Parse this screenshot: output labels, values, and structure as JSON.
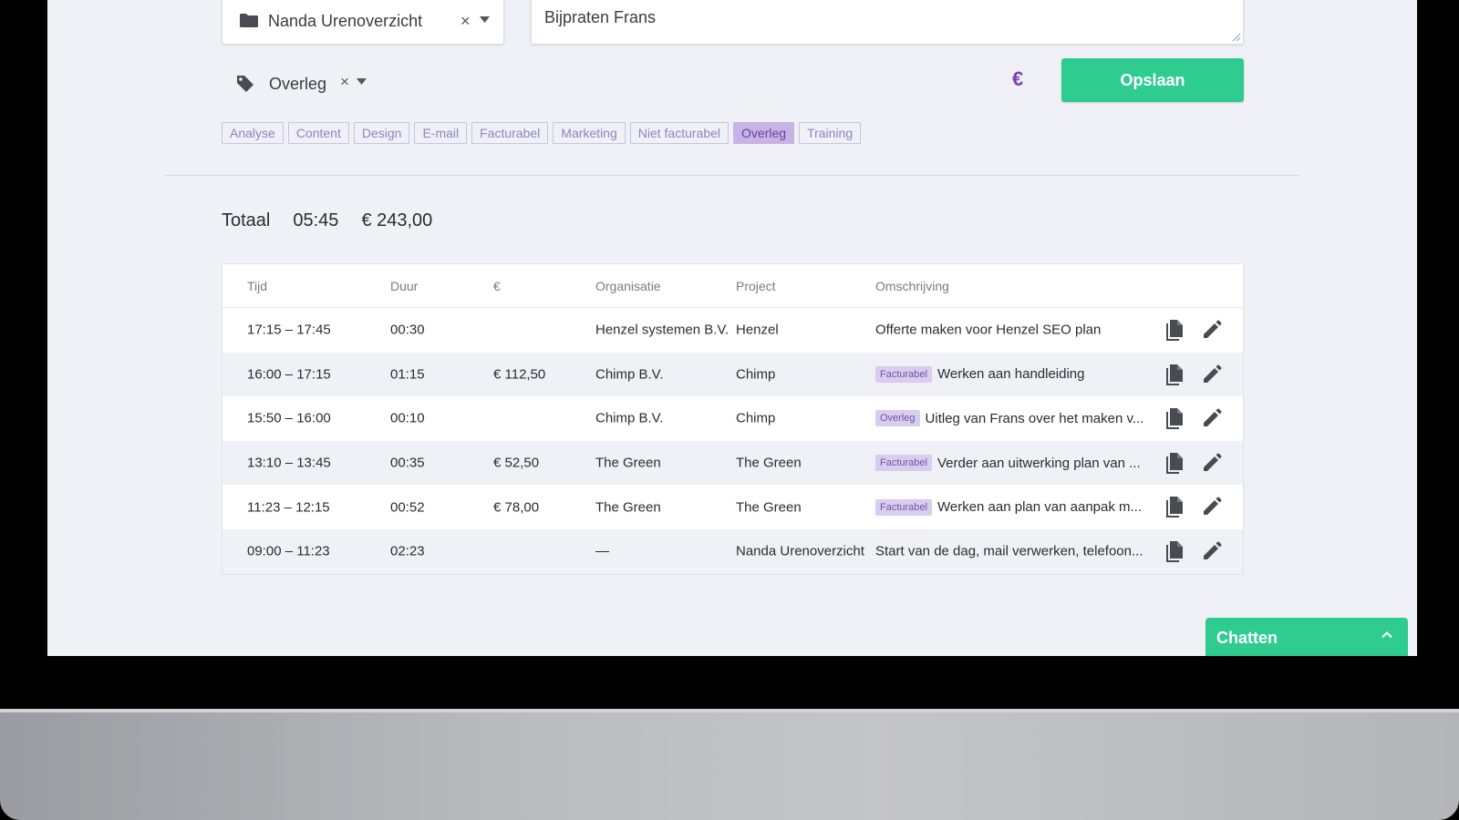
{
  "form": {
    "project_select": {
      "value": "Nanda Urenoverzicht",
      "clear": "×"
    },
    "description": {
      "value": "Bijpraten Frans"
    },
    "tag_select": {
      "value": "Overleg",
      "clear": "×"
    },
    "billable_toggle": "€",
    "save_label": "Opslaan",
    "tags": [
      "Analyse",
      "Content",
      "Design",
      "E-mail",
      "Facturabel",
      "Marketing",
      "Niet facturabel",
      "Overleg",
      "Training"
    ],
    "active_tag": "Overleg"
  },
  "totals": {
    "label": "Totaal",
    "duration": "05:45",
    "amount": "€ 243,00"
  },
  "table": {
    "headers": [
      "Tijd",
      "Duur",
      "€",
      "Organisatie",
      "Project",
      "Omschrijving"
    ],
    "rows": [
      {
        "time": "17:15 – 17:45",
        "duration": "00:30",
        "amount": "",
        "organisation": "Henzel systemen B.V.",
        "project": "Henzel",
        "badge": "",
        "description": "Offerte maken voor Henzel SEO plan"
      },
      {
        "time": "16:00 – 17:15",
        "duration": "01:15",
        "amount": "€ 112,50",
        "organisation": "Chimp B.V.",
        "project": "Chimp",
        "badge": "Facturabel",
        "description": "Werken aan handleiding"
      },
      {
        "time": "15:50 – 16:00",
        "duration": "00:10",
        "amount": "",
        "organisation": "Chimp B.V.",
        "project": "Chimp",
        "badge": "Overleg",
        "description": "Uitleg van Frans over het maken v..."
      },
      {
        "time": "13:10 – 13:45",
        "duration": "00:35",
        "amount": "€ 52,50",
        "organisation": "The Green",
        "project": "The Green",
        "badge": "Facturabel",
        "description": "Verder aan uitwerking plan van ..."
      },
      {
        "time": "11:23 – 12:15",
        "duration": "00:52",
        "amount": "€ 78,00",
        "organisation": "The Green",
        "project": "The Green",
        "badge": "Facturabel",
        "description": "Werken aan plan van aanpak m..."
      },
      {
        "time": "09:00 – 11:23",
        "duration": "02:23",
        "amount": "",
        "organisation": "—",
        "project": "Nanda Urenoverzicht",
        "badge": "",
        "description": "Start van de dag, mail verwerken, telefoon..."
      }
    ]
  },
  "chat": {
    "label": "Chatten"
  },
  "colors": {
    "accent_green": "#2ecc8f",
    "accent_purple": "#7b3fb3",
    "background": "#f0f1f7"
  }
}
